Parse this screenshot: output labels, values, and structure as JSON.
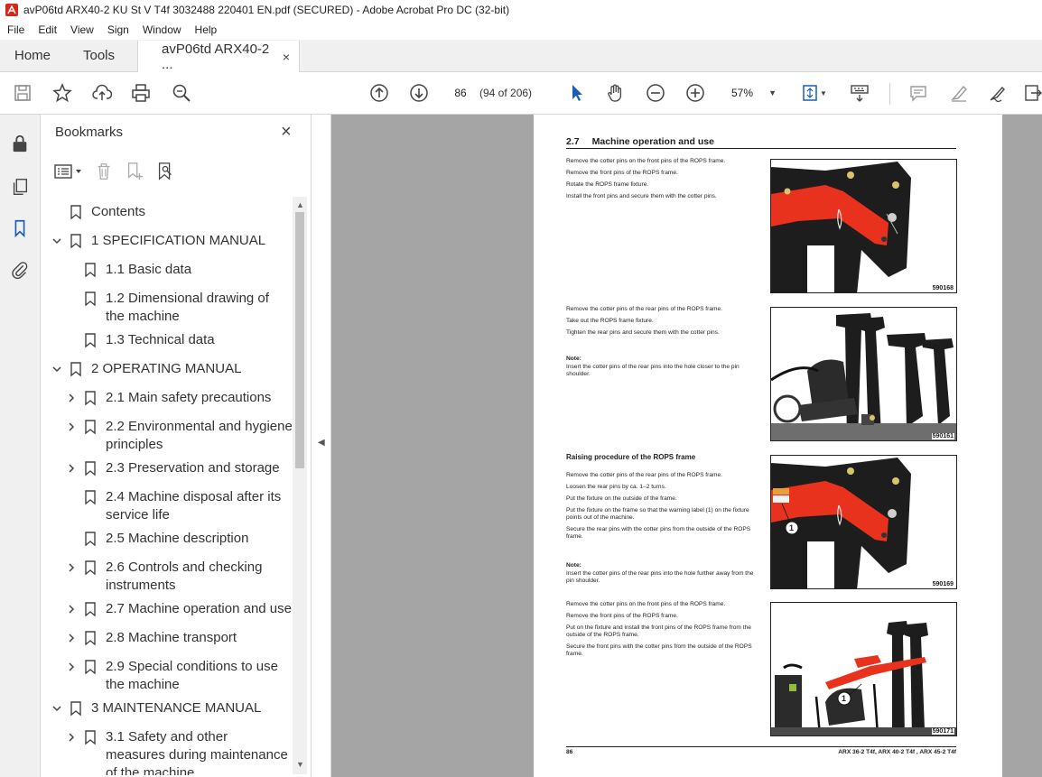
{
  "window": {
    "title": "avP06td ARX40-2 KU St V T4f 3032488 220401 EN.pdf (SECURED) - Adobe Acrobat Pro DC (32-bit)"
  },
  "menu": [
    "File",
    "Edit",
    "View",
    "Sign",
    "Window",
    "Help"
  ],
  "tabs": {
    "home": "Home",
    "tools": "Tools",
    "document": "avP06td ARX40-2 ...",
    "close": "×"
  },
  "toolbar": {
    "page_number": "86",
    "page_of": "(94 of 206)",
    "zoom": "57%"
  },
  "bookmarks": {
    "title": "Bookmarks",
    "close": "×",
    "items": [
      {
        "label": "Contents"
      },
      {
        "label": "1 SPECIFICATION MANUAL"
      },
      {
        "label": "1.1 Basic data"
      },
      {
        "label": "1.2 Dimensional drawing of the machine"
      },
      {
        "label": "1.3 Technical data"
      },
      {
        "label": "2 OPERATING MANUAL"
      },
      {
        "label": "2.1 Main safety precautions"
      },
      {
        "label": "2.2 Environmental and hygiene principles"
      },
      {
        "label": "2.3 Preservation and storage"
      },
      {
        "label": "2.4 Machine disposal after its service life"
      },
      {
        "label": "2.5 Machine description"
      },
      {
        "label": "2.6 Controls and checking instruments"
      },
      {
        "label": "2.7 Machine operation and use"
      },
      {
        "label": "2.8 Machine transport"
      },
      {
        "label": "2.9 Special conditions to use the machine"
      },
      {
        "label": "3 MAINTENANCE MANUAL"
      },
      {
        "label": "3.1 Safety and other measures during maintenance of the machine"
      }
    ]
  },
  "page": {
    "section_number": "2.7",
    "section_title": "Machine operation and use",
    "block1": [
      "Remove the cotter pins on the front pins of the ROPS frame.",
      "Remove the front pins of the ROPS frame.",
      "Rotate the ROPS frame fixture.",
      "Install the front pins and secure them with the cotter pins."
    ],
    "block2": [
      "Remove the cotter pins of the rear pins of the ROPS frame.",
      "Take out the ROPS frame fixture.",
      "Tighten the rear pins and secure them with the cotter pins."
    ],
    "note_label": "Note:",
    "note2": "Insert the cotter pins of the rear pins into the hole closer to the pin shoulder.",
    "raising_title": "Raising procedure of the ROPS frame",
    "block3": [
      "Remove the cotter pins of the rear pins of the ROPS frame.",
      "Loosen the rear pins by ca. 1–2 turns.",
      "Put the fixture on the outside of the frame.",
      "Put the fixture on the frame so that the warning label (1) on the fixture points out of the machine.",
      "Secure the rear pins with the cotter pins from the outside of the ROPS frame."
    ],
    "note3": "Insert the cotter pins of the rear pins into the hole further away from the pin shoulder.",
    "block4": [
      "Remove the cotter pins on the front pins of the ROPS frame.",
      "Remove the front pins of the ROPS frame.",
      "Put on the fixture and install the front pins of the ROPS frame from the outside of the ROPS frame.",
      "Secure the front pins with the cotter pins from the outside of the ROPS frame."
    ],
    "figures": [
      "590168",
      "590161",
      "590169",
      "590171"
    ],
    "callout": "1",
    "footer_page": "86",
    "footer_model": "ARX 36-2 T4f, ARX 40-2 T4f , ARX 45-2 T4f"
  },
  "colors": {
    "accent_red": "#e8321e",
    "frame_black": "#1d1d1d",
    "viewer_bg": "#a5a5a5"
  }
}
